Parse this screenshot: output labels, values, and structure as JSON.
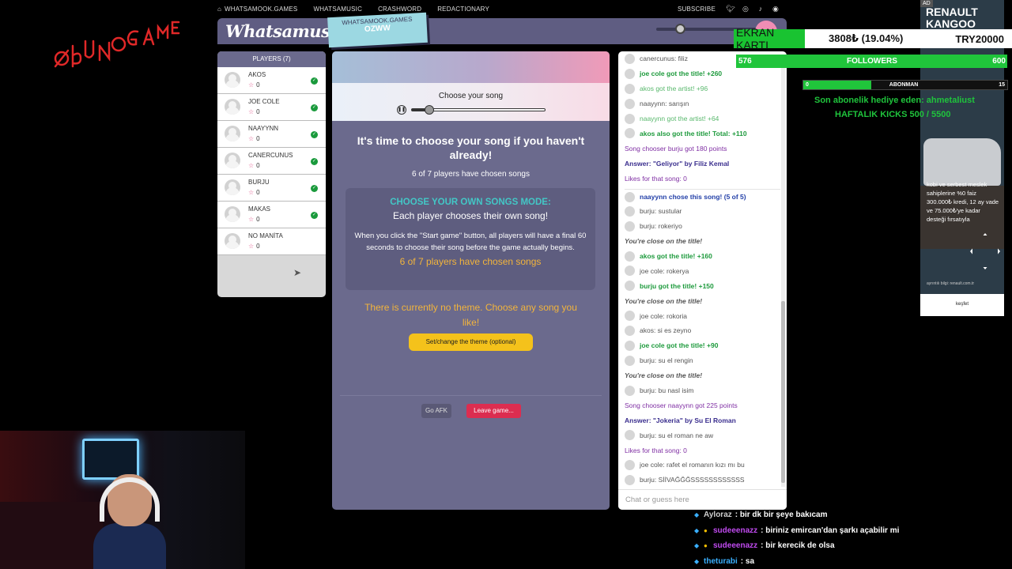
{
  "stream": {
    "logo_text": "ØBUNOGAME"
  },
  "topnav": {
    "links": [
      "WHATSAMOOK.GAMES",
      "WHATSAMUSIC",
      "CRASHWORD",
      "REDACTIONARY"
    ],
    "subscribe": "SUBSCRIBE"
  },
  "header": {
    "logo": "Whatsamusic",
    "room_site": "WHATSAMOOK.GAMES",
    "room_code": "OZWW"
  },
  "players": {
    "title": "PLAYERS (7)",
    "list": [
      {
        "name": "AKOS",
        "score": "0",
        "ready": true
      },
      {
        "name": "JOE COLE",
        "score": "0",
        "ready": true
      },
      {
        "name": "NAAYYNN",
        "score": "0",
        "ready": true
      },
      {
        "name": "CANERCUNUS",
        "score": "0",
        "ready": true
      },
      {
        "name": "BURJU",
        "score": "0",
        "ready": true
      },
      {
        "name": "MAKAS",
        "score": "0",
        "ready": true
      },
      {
        "name": "NO MANİTA",
        "score": "0",
        "ready": false
      }
    ]
  },
  "main": {
    "choose_label": "Choose your song",
    "playback_progress": 0.13,
    "title": "It's time to choose your song if you haven't already!",
    "chosen_count": "6 of 7 players have chosen songs",
    "mode_title": "CHOOSE YOUR OWN SONGS MODE:",
    "mode_sub": "Each player chooses their own song!",
    "mode_desc": "When you click the \"Start game\" button, all players will have a final 60 seconds to choose their song before the game actually begins.",
    "mode_count": "6 of 7 players have chosen songs",
    "theme_text": "There is currently no theme. Choose any song you like!",
    "theme_button": "Set/change the theme (optional)",
    "afk_button": "Go AFK",
    "leave_button": "Leave game..."
  },
  "chat": {
    "messages": [
      {
        "text": "canercunus: filiz",
        "style": "",
        "avatar": true
      },
      {
        "text": "joe cole got the title! +260",
        "style": "green",
        "avatar": true
      },
      {
        "text": "akos got the artist! +96",
        "style": "lightgreen",
        "avatar": true
      },
      {
        "text": "naayynn: sarışın",
        "style": "",
        "avatar": true
      },
      {
        "text": "naayynn got the artist! +64",
        "style": "lightgreen",
        "avatar": true
      },
      {
        "text": "akos also got the title! Total: +110",
        "style": "green",
        "avatar": true
      },
      {
        "text": "Song chooser burju got 180 points",
        "style": "purple",
        "avatar": false
      },
      {
        "text": "Answer: \"Geliyor\" by Filiz Kemal",
        "style": "indigo",
        "avatar": false
      },
      {
        "text": "Likes for that song: 0",
        "style": "purple",
        "avatar": false
      },
      {
        "text": "naayynn chose this song! (5 of 5)",
        "style": "blue sep",
        "avatar": true
      },
      {
        "text": "burju: sustular",
        "style": "",
        "avatar": true
      },
      {
        "text": "burju: rokeriyo",
        "style": "",
        "avatar": true
      },
      {
        "text": "You're close on the title!",
        "style": "close",
        "avatar": false
      },
      {
        "text": "akos got the title! +160",
        "style": "green",
        "avatar": true
      },
      {
        "text": "joe cole: rokerya",
        "style": "",
        "avatar": true
      },
      {
        "text": "burju got the title! +150",
        "style": "green",
        "avatar": true
      },
      {
        "text": "You're close on the title!",
        "style": "close",
        "avatar": false
      },
      {
        "text": "joe cole: rokoria",
        "style": "",
        "avatar": true
      },
      {
        "text": "akos: si es zeyno",
        "style": "",
        "avatar": true
      },
      {
        "text": "joe cole got the title! +90",
        "style": "green",
        "avatar": true
      },
      {
        "text": "burju: su el rengin",
        "style": "",
        "avatar": true
      },
      {
        "text": "You're close on the title!",
        "style": "close",
        "avatar": false
      },
      {
        "text": "burju: bu nasl isim",
        "style": "",
        "avatar": true
      },
      {
        "text": "Song chooser naayynn got 225 points",
        "style": "purple",
        "avatar": false
      },
      {
        "text": "Answer: \"Jokeria\" by Su El Roman",
        "style": "indigo",
        "avatar": false
      },
      {
        "text": "burju: su el roman ne aw",
        "style": "",
        "avatar": true
      },
      {
        "text": "Likes for that song: 0",
        "style": "purple",
        "avatar": false
      },
      {
        "text": "joe cole: rafet el romanın kızı mı bu",
        "style": "",
        "avatar": true
      },
      {
        "text": "burju: SİİVAĞĞĞSSSSSSSSSSSS",
        "style": "",
        "avatar": true
      }
    ],
    "placeholder": "Chat or guess here"
  },
  "overlay": {
    "ad_label": "AD",
    "ad_brand": "RENAULT KANGOO",
    "ad_text": "kobi ve serbest meslek sahiplerine %0 faiz 300.000₺ kredi, 12 ay vade ve 75.000₺'ye kadar desteği fırsatıyla",
    "ad_small": "ayrıntılı bilgi: renault.com.tr",
    "ad_cta": "keşfet",
    "goal_label": "EKRAN KARTI",
    "goal_progress": "3808₺ (19.04%)",
    "goal_target": "TRY20000",
    "followers_current": "576",
    "followers_label": "FOLLOWERS",
    "followers_goal": "600",
    "abone_current": "0",
    "abone_label": "ABONMAN",
    "abone_goal": "15",
    "sub_gift": "Son abonelik hediye eden: ahmetaliust",
    "kicks": "HAFTALIK KICKS 500 / 5500"
  },
  "stream_chat": [
    {
      "user": "Ayloraz",
      "text": ": bir dk bir şeye bakıcam",
      "color": "#cfcfcf"
    },
    {
      "user": "sudeeenazz",
      "text": ": biriniz emircan'dan şarkı açabilir mi",
      "color": "#c14bf0"
    },
    {
      "user": "sudeeenazz",
      "text": ": bir kerecik de olsa",
      "color": "#c14bf0"
    },
    {
      "user": "theturabi",
      "text": ": sa",
      "color": "#3ab0ff"
    }
  ]
}
